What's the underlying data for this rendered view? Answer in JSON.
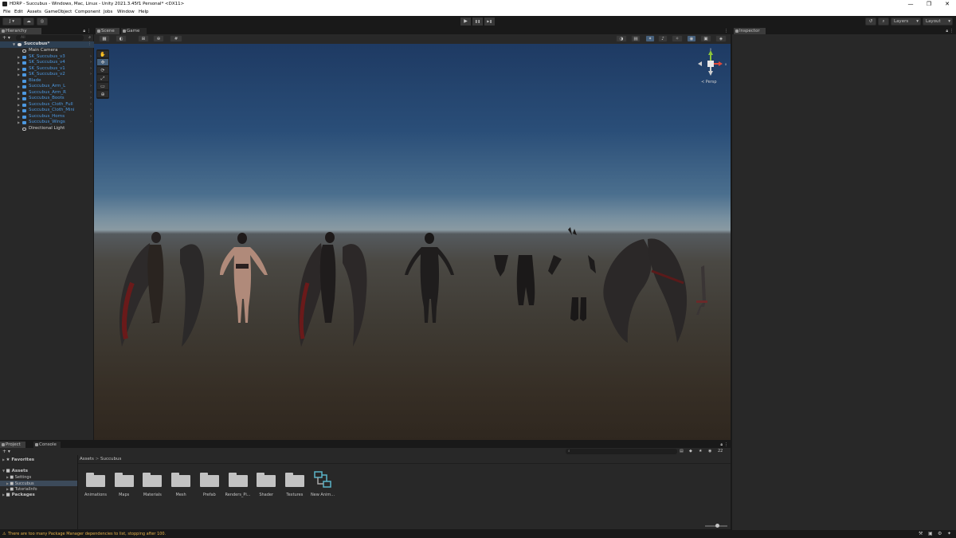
{
  "window": {
    "title": "HDRP - Succubus - Windows, Mac, Linux - Unity 2021.3.45f1 Personal* <DX11>",
    "controls": [
      "—",
      "❐",
      "✕"
    ]
  },
  "menu": [
    "File",
    "Edit",
    "Assets",
    "GameObject",
    "Component",
    "Jobs",
    "Window",
    "Help"
  ],
  "toolbar": {
    "account_label": "J ▾",
    "cloud_icon": "cloud-icon",
    "collab_icon": "collab-icon",
    "play": "▶",
    "pause": "❚❚",
    "step": "▶❚",
    "history_icon": "history-icon",
    "search_icon": "search-icon",
    "layers_label": "Layers",
    "layout_label": "Layout"
  },
  "hierarchy": {
    "tab": "Hierarchy",
    "add": "+ ▾",
    "search_placeholder": "All",
    "scene_name": "Succubus*",
    "items": [
      {
        "label": "Main Camera",
        "type": "camera"
      },
      {
        "label": "SK_Succubus_v3",
        "type": "prefab",
        "expandable": true
      },
      {
        "label": "SK_Succubus_v4",
        "type": "prefab",
        "expandable": true
      },
      {
        "label": "SK_Succubus_v1",
        "type": "prefab",
        "expandable": true
      },
      {
        "label": "SK_Succubus_v2",
        "type": "prefab",
        "expandable": true
      },
      {
        "label": "Blade",
        "type": "prefab",
        "expandable": false
      },
      {
        "label": "Succubus_Arm_L",
        "type": "prefab",
        "expandable": true
      },
      {
        "label": "Succubus_Arm_R",
        "type": "prefab",
        "expandable": true
      },
      {
        "label": "Succubus_Boots",
        "type": "prefab",
        "expandable": true
      },
      {
        "label": "Succubus_Cloth_Full",
        "type": "prefab",
        "expandable": true
      },
      {
        "label": "Succubus_Cloth_Mini",
        "type": "prefab",
        "expandable": true
      },
      {
        "label": "Succubus_Horns",
        "type": "prefab",
        "expandable": true
      },
      {
        "label": "Succubus_Wings",
        "type": "prefab",
        "expandable": true
      },
      {
        "label": "Directional Light",
        "type": "light"
      }
    ]
  },
  "scene": {
    "tabs": [
      "Scene",
      "Game"
    ],
    "persp_label": "≺ Persp",
    "tools": [
      "hand-tool",
      "move-tool",
      "rotate-tool",
      "scale-tool",
      "rect-tool",
      "transform-tool"
    ],
    "tool_glyphs": [
      "✋",
      "✥",
      "⟳",
      "⤢",
      "▭",
      "⊕"
    ],
    "gizmo_axes": {
      "y": "y",
      "x": "x"
    }
  },
  "inspector": {
    "tab": "Inspector"
  },
  "project": {
    "tabs": [
      "Project",
      "Console"
    ],
    "add": "+ ▾",
    "favorites_label": "Favorites",
    "tree": {
      "assets_label": "Assets",
      "children": [
        "Settings",
        "Succubus",
        "TutorialInfo"
      ],
      "packages_label": "Packages"
    },
    "breadcrumb": [
      "Assets",
      "Succubus"
    ],
    "breadcrumb_sep": ">",
    "hidden_packages_count": "22",
    "folders": [
      "Animations",
      "Maps",
      "Materials",
      "Mesh",
      "Prefab",
      "Renders_Pi...",
      "Shader",
      "Textures"
    ],
    "asset": "New Anim..."
  },
  "status": {
    "message": "There are too many Package Manager dependencies to list, stopping after 100."
  },
  "colors": {
    "accent_blue": "#4c98e0",
    "warning": "#e6b14a",
    "panel": "#282828",
    "background": "#191919"
  }
}
